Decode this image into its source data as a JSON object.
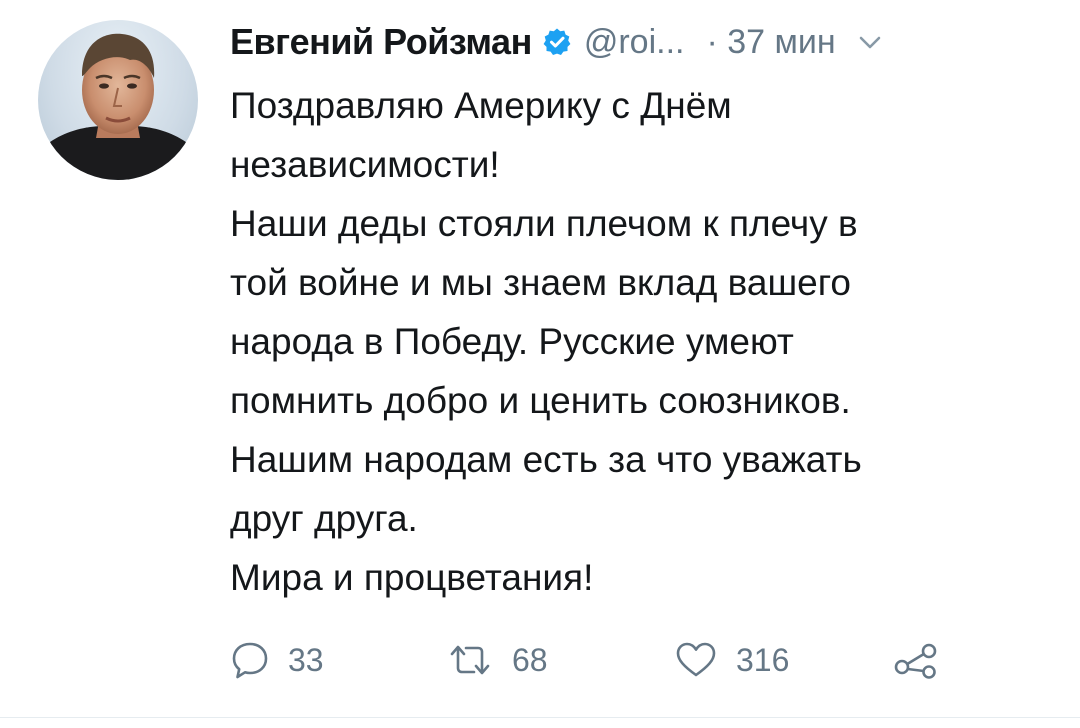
{
  "tweet": {
    "author": {
      "display_name": "Евгений Ройзман",
      "handle": "@roi...",
      "verified": true,
      "avatar_icon": "user-photo"
    },
    "time": "· 37 мин",
    "text_lines": [
      "Поздравляю  Америку с Днём",
      "независимости!",
      "Наши деды стояли плечом к плечу в",
      "той войне и мы знаем вклад вашего",
      "народа в Победу. Русские умеют",
      "помнить добро и ценить союзников.",
      "Нашим народам есть за что уважать",
      "друг друга.",
      "Мира и процветания!"
    ],
    "actions": {
      "reply": {
        "icon": "reply-icon",
        "count": "33"
      },
      "retweet": {
        "icon": "retweet-icon",
        "count": "68"
      },
      "like": {
        "icon": "heart-icon",
        "count": "316"
      },
      "share": {
        "icon": "share-icon"
      }
    }
  },
  "colors": {
    "text_primary": "#14171a",
    "text_secondary": "#657786",
    "verified_blue": "#1da1f2",
    "background": "#ffffff"
  }
}
